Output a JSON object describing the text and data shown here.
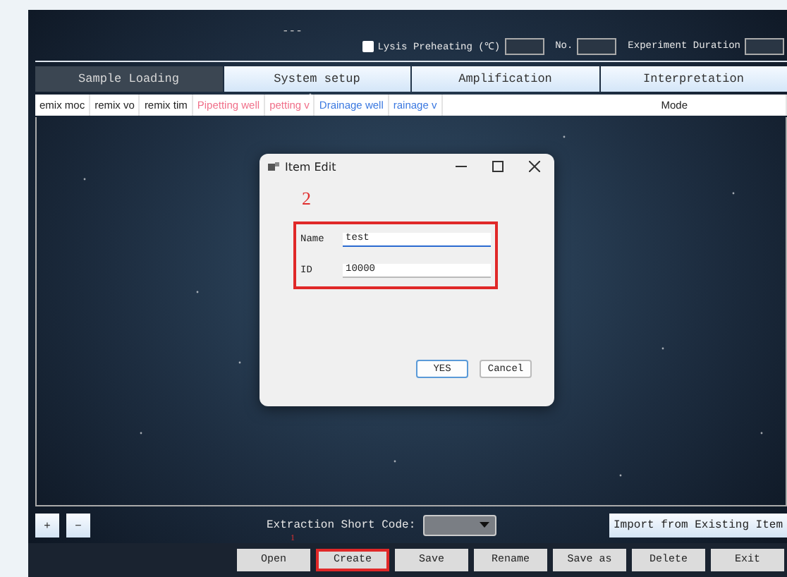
{
  "header": {
    "title": "---",
    "lysis": {
      "label": "Lysis Preheating (℃)",
      "checked": false
    },
    "no_label": "No.",
    "duration_label": "Experiment Duration"
  },
  "tabs": [
    {
      "label": "Sample Loading",
      "selected": true
    },
    {
      "label": "System setup",
      "selected": false
    },
    {
      "label": "Amplification",
      "selected": false
    },
    {
      "label": "Interpretation",
      "selected": false
    }
  ],
  "table": {
    "columns": [
      {
        "label": "emix moc",
        "color": "#222222"
      },
      {
        "label": "remix  vo",
        "color": "#222222"
      },
      {
        "label": "remix tim",
        "color": "#222222"
      },
      {
        "label": "Pipetting well",
        "color": "#f0708a"
      },
      {
        "label": "petting v",
        "color": "#f0708a"
      },
      {
        "label": "Drainage well",
        "color": "#3a78e0"
      },
      {
        "label": "rainage v",
        "color": "#3a78e0"
      },
      {
        "label": "Mode",
        "color": "#222222"
      }
    ]
  },
  "dialog": {
    "title": "Item Edit",
    "annotation": "2",
    "fields": [
      {
        "label": "Name",
        "value": "test",
        "focused": true
      },
      {
        "label": "ID",
        "value": "10000",
        "focused": false
      }
    ],
    "buttons": [
      {
        "label": "YES",
        "default": true
      },
      {
        "label": "Cancel",
        "default": false
      }
    ]
  },
  "controls": {
    "add": "+",
    "remove": "−",
    "short_code_label": "Extraction Short Code:",
    "import_button": "Import from Existing Item"
  },
  "annotation": "1",
  "buttons": [
    {
      "label": "Open",
      "highlighted": false
    },
    {
      "label": "Create",
      "highlighted": true
    },
    {
      "label": "Save",
      "highlighted": false
    },
    {
      "label": "Rename",
      "highlighted": false
    },
    {
      "label": "Save as",
      "highlighted": false
    },
    {
      "label": "Delete",
      "highlighted": false
    },
    {
      "label": "Exit",
      "highlighted": false
    }
  ]
}
